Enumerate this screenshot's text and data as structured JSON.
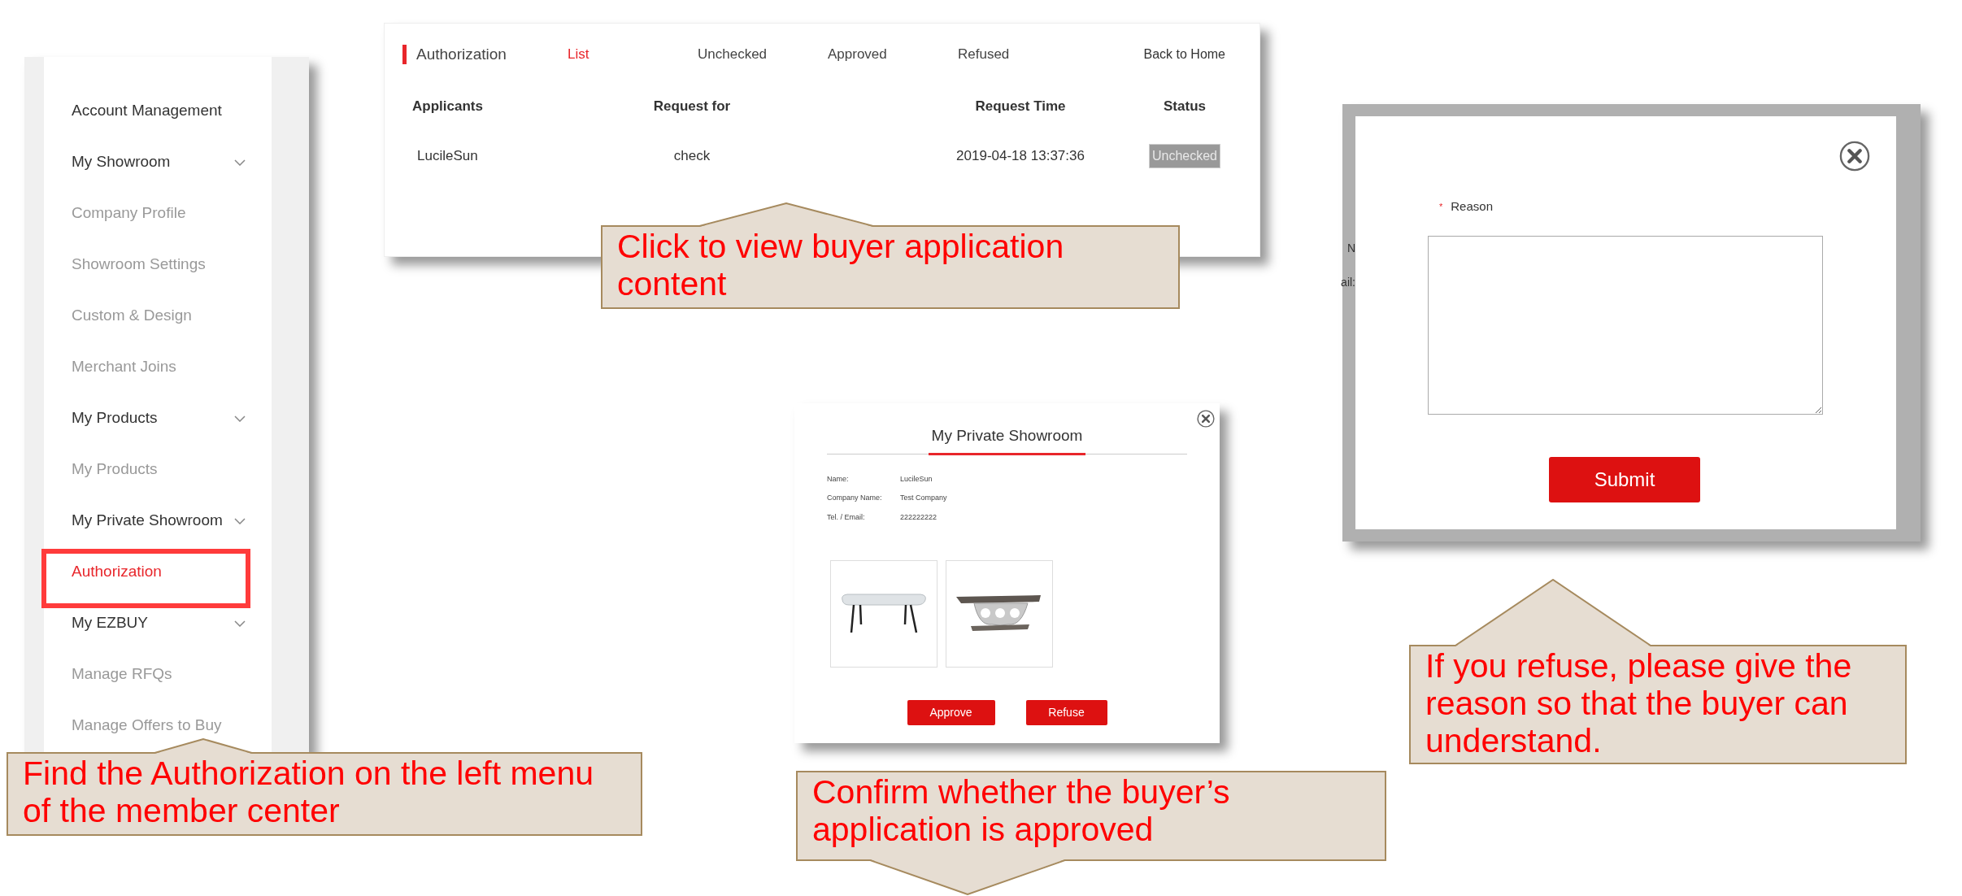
{
  "sidebar": {
    "items": [
      {
        "label": "Account Management",
        "kind": "heading",
        "selected": false
      },
      {
        "label": "My Showroom",
        "kind": "group",
        "selected": false
      },
      {
        "label": "Company Profile",
        "kind": "link",
        "selected": false
      },
      {
        "label": "Showroom Settings",
        "kind": "link",
        "selected": false
      },
      {
        "label": "Custom & Design",
        "kind": "link",
        "selected": false
      },
      {
        "label": "Merchant Joins",
        "kind": "link",
        "selected": false
      },
      {
        "label": "My Products",
        "kind": "group",
        "selected": false
      },
      {
        "label": "My Products",
        "kind": "link",
        "selected": false
      },
      {
        "label": "My Private Showroom",
        "kind": "group",
        "selected": false
      },
      {
        "label": "Authorization",
        "kind": "link",
        "selected": true
      },
      {
        "label": "My EZBUY",
        "kind": "group",
        "selected": false
      },
      {
        "label": "Manage RFQs",
        "kind": "link",
        "selected": false
      },
      {
        "label": "Manage Offers to Buy",
        "kind": "link",
        "selected": false
      }
    ]
  },
  "list_panel": {
    "title": "Authorization",
    "tabs": [
      {
        "label": "List",
        "selected": true
      },
      {
        "label": "Unchecked",
        "selected": false
      },
      {
        "label": "Approved",
        "selected": false
      },
      {
        "label": "Refused",
        "selected": false
      }
    ],
    "back_link": "Back to Home",
    "table": {
      "columns": [
        "Applicants",
        "Request for",
        "Request Time",
        "Status"
      ],
      "rows": [
        {
          "applicant": "LucileSun",
          "request_for": "check",
          "request_time": "2019-04-18 13:37:36",
          "status": "Unchecked"
        }
      ]
    }
  },
  "review_dialog": {
    "title": "My Private Showroom",
    "fields": [
      {
        "label": "Name:",
        "value": "LucileSun"
      },
      {
        "label": "Company Name:",
        "value": "Test Company"
      },
      {
        "label": "Tel. / Email:",
        "value": "222222222"
      }
    ],
    "buttons": [
      "Approve",
      "Refuse"
    ]
  },
  "refuse_dialog": {
    "background_texts": [
      "N",
      "ail:"
    ],
    "required_mark": "*",
    "label": "Reason",
    "button": "Submit"
  },
  "callouts": [
    {
      "text": "Find the Authorization on the left menu of the member center",
      "kind": "up"
    },
    {
      "text": "Click to view buyer application content",
      "kind": "up"
    },
    {
      "text": "Confirm whether the buyer’s application is approved",
      "kind": "down"
    },
    {
      "text": "If you refuse, please give the reason so that the buyer can understand.",
      "kind": "up"
    }
  ]
}
